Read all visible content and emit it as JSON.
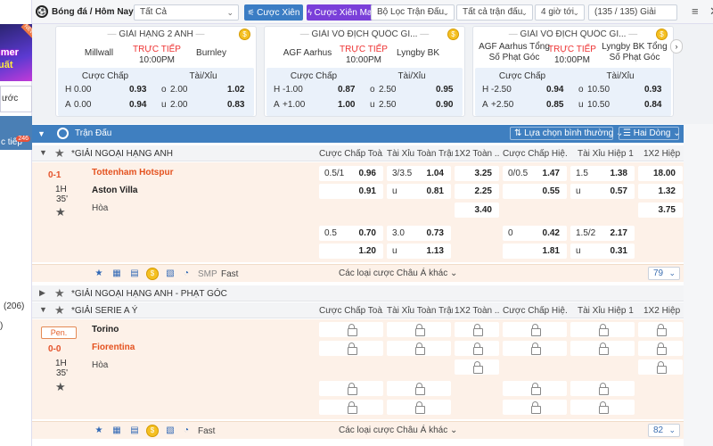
{
  "left_panel": {
    "promo_line1": "umer",
    "promo_line2": "uất",
    "promo_tag": "NEW",
    "white_text": "ước",
    "blue_text": "c tiếp",
    "blue_badge": "246",
    "count": "(206)",
    "small_text": ")"
  },
  "topbar": {
    "brand": "Bóng đá / Hôm Nay",
    "filter1": "Tất Cả",
    "btn_xien": "Cược Xiên",
    "btn_mayman": "Cược Xiên May Mắn",
    "league_filter": "Bộ Lọc Trận Đấu",
    "match_filter": "Tất cả trận đấu",
    "time_filter": "4 giờ tới",
    "match_count": "(135 / 135) Giải",
    "menu_icon": "≡",
    "close_icon": "✕"
  },
  "featured": [
    {
      "league": "GIẢI HẠNG 2 ANH",
      "home": "Millwall",
      "away": "Burnley",
      "live": "TRỰC TIẾP",
      "time": "10:00PM",
      "h1": "Cược Chấp",
      "h2": "Tài/Xỉu",
      "r1": [
        "H",
        "0.00",
        "0.93",
        "o",
        "2.00",
        "1.02"
      ],
      "r2": [
        "A",
        "0.00",
        "0.94",
        "u",
        "2.00",
        "0.83"
      ]
    },
    {
      "league": "GIẢI VÔ ĐỊCH QUỐC GI...",
      "home": "AGF Aarhus",
      "away": "Lyngby BK",
      "live": "TRỰC TIẾP",
      "time": "10:00PM",
      "h1": "Cược Chấp",
      "h2": "Tài/Xỉu",
      "r1": [
        "H",
        "-1.00",
        "0.87",
        "o",
        "2.50",
        "0.95"
      ],
      "r2": [
        "A",
        "+1.00",
        "1.00",
        "u",
        "2.50",
        "0.90"
      ]
    },
    {
      "league": "GIẢI VÔ ĐỊCH QUỐC GI...",
      "home": "AGF Aarhus Tổng Số Phạt Góc",
      "away": "Lyngby BK Tổng Số Phạt Góc",
      "live": "TRỰC TIẾP",
      "time": "10:00PM",
      "h1": "Cược Chấp",
      "h2": "Tài/Xỉu",
      "r1": [
        "H",
        "-2.50",
        "0.94",
        "o",
        "10.50",
        "0.93"
      ],
      "r2": [
        "A",
        "+2.50",
        "0.85",
        "u",
        "10.50",
        "0.84"
      ]
    }
  ],
  "list_header": {
    "title": "Trận Đấu",
    "sort": "Lựa chọn bình thường",
    "view": "Hai Dòng"
  },
  "columns": [
    "Cược Chấp Toà...",
    "Tài Xỉu Toàn Trận",
    "1X2 Toàn ...",
    "Cược Chấp Hiệ...",
    "Tài Xỉu Hiệp 1",
    "1X2 Hiệp 1"
  ],
  "leagues": [
    {
      "name": "*GIẢI NGOẠI HẠNG ANH"
    },
    {
      "name": "*GIẢI NGOẠI HẠNG ANH - PHẠT GÓC"
    },
    {
      "name": "*GIẢI SERIE A Ý"
    }
  ],
  "match1": {
    "score": "0-1",
    "half": "1H",
    "minute": "35'",
    "home": "Tottenham Hotspur",
    "away": "Aston Villa",
    "draw": "Hòa",
    "row1": [
      "0.5/1",
      "0.96",
      "3/3.5",
      "1.04",
      "3.25",
      "0/0.5",
      "1.47",
      "1.5",
      "1.38",
      "18.00"
    ],
    "row2": [
      "",
      "0.91",
      "u",
      "0.81",
      "2.25",
      "",
      "0.55",
      "u",
      "0.57",
      "1.32"
    ],
    "row3": [
      "3.40",
      "3.75"
    ],
    "row4": [
      "0.5",
      "0.70",
      "3.0",
      "0.73",
      "0",
      "0.42",
      "1.5/2",
      "2.17"
    ],
    "row5": [
      "",
      "1.20",
      "u",
      "1.13",
      "",
      "1.81",
      "u",
      "0.31"
    ],
    "more": "Các loại cược Châu Á khác",
    "count": "79",
    "smp": "SMP",
    "fast": "Fast"
  },
  "match2": {
    "pen": "Pen.",
    "score": "0-0",
    "half": "1H",
    "minute": "35'",
    "home": "Torino",
    "away": "Fiorentina",
    "draw": "Hòa",
    "more": "Các loại cược Châu Á khác",
    "count": "82",
    "fast": "Fast"
  }
}
